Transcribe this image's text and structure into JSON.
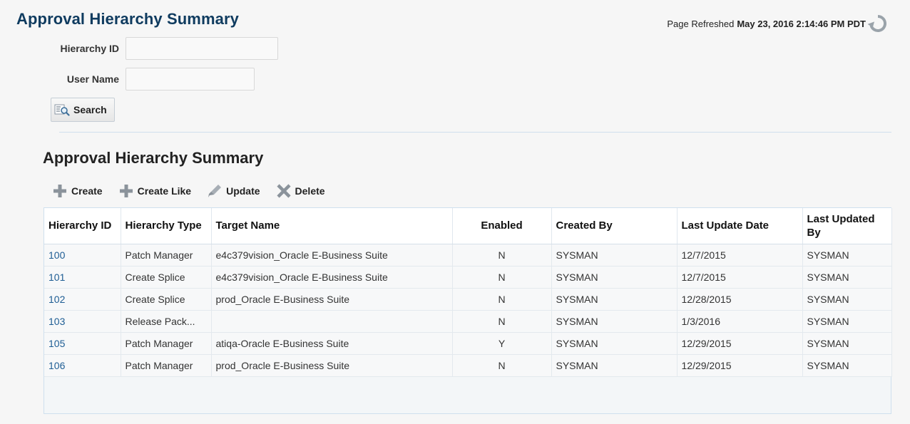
{
  "page": {
    "title": "Approval Hierarchy Summary",
    "refresh_label": "Page Refreshed",
    "refresh_timestamp": "May 23, 2016 2:14:46 PM PDT"
  },
  "search": {
    "hierarchy_id_label": "Hierarchy ID",
    "hierarchy_id_value": "",
    "user_name_label": "User Name",
    "user_name_value": "",
    "search_button_label": "Search"
  },
  "summary": {
    "title": "Approval Hierarchy Summary",
    "toolbar": {
      "create_label": "Create",
      "create_like_label": "Create Like",
      "update_label": "Update",
      "delete_label": "Delete"
    },
    "columns": [
      "Hierarchy ID",
      "Hierarchy Type",
      "Target Name",
      "Enabled",
      "Created By",
      "Last Update Date",
      "Last Updated By"
    ],
    "rows": [
      {
        "id": "100",
        "type": "Patch Manager",
        "target": "e4c379vision_Oracle E-Business Suite",
        "enabled": "N",
        "created_by": "SYSMAN",
        "last_update": "12/7/2015",
        "updated_by": "SYSMAN"
      },
      {
        "id": "101",
        "type": "Create Splice",
        "target": "e4c379vision_Oracle E-Business Suite",
        "enabled": "N",
        "created_by": "SYSMAN",
        "last_update": "12/7/2015",
        "updated_by": "SYSMAN"
      },
      {
        "id": "102",
        "type": "Create Splice",
        "target": "prod_Oracle E-Business Suite",
        "enabled": "N",
        "created_by": "SYSMAN",
        "last_update": "12/28/2015",
        "updated_by": "SYSMAN"
      },
      {
        "id": "103",
        "type": "Release Pack...",
        "target": "",
        "enabled": "N",
        "created_by": "SYSMAN",
        "last_update": "1/3/2016",
        "updated_by": "SYSMAN"
      },
      {
        "id": "105",
        "type": "Patch Manager",
        "target": "atiqa-Oracle E-Business Suite",
        "enabled": "Y",
        "created_by": "SYSMAN",
        "last_update": "12/29/2015",
        "updated_by": "SYSMAN"
      },
      {
        "id": "106",
        "type": "Patch Manager",
        "target": "prod_Oracle E-Business Suite",
        "enabled": "N",
        "created_by": "SYSMAN",
        "last_update": "12/29/2015",
        "updated_by": "SYSMAN"
      }
    ]
  },
  "icons": {
    "refresh": "refresh-icon",
    "search": "search-icon",
    "create": "plus-icon",
    "create_like": "plus-icon",
    "update": "pencil-icon",
    "delete": "x-icon"
  },
  "colors": {
    "title": "#0f3b5f",
    "link": "#1e5d94",
    "background": "#f6f6f6"
  }
}
